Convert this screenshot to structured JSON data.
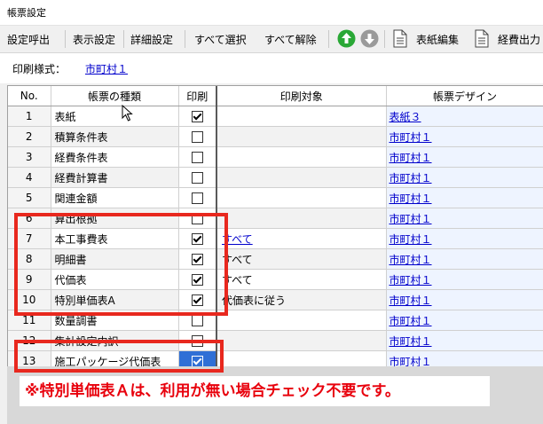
{
  "window": {
    "title": "帳票設定"
  },
  "toolbar": {
    "load_settings": "設定呼出",
    "display_settings": "表示設定",
    "detail_settings": "詳細設定",
    "select_all": "すべて選択",
    "deselect_all": "すべて解除",
    "up_icon": "arrow-up-circle",
    "down_icon": "arrow-down-circle",
    "form_edit": "表紙編集",
    "cost_output": "経費出力"
  },
  "print_style": {
    "label": "印刷様式：",
    "value": "市町村１"
  },
  "table": {
    "headers": [
      "No.",
      "帳票の種類",
      "印刷",
      "印刷対象",
      "帳票デザイン"
    ],
    "rows": [
      {
        "no": "1",
        "name": "表紙",
        "print": true,
        "target": "",
        "design": "表紙３"
      },
      {
        "no": "2",
        "name": "積算条件表",
        "print": false,
        "target": "",
        "design": "市町村１"
      },
      {
        "no": "3",
        "name": "経費条件表",
        "print": false,
        "target": "",
        "design": "市町村１"
      },
      {
        "no": "4",
        "name": "経費計算書",
        "print": false,
        "target": "",
        "design": "市町村１"
      },
      {
        "no": "5",
        "name": "関連金額",
        "print": false,
        "target": "",
        "design": "市町村１"
      },
      {
        "no": "6",
        "name": "算出根拠",
        "print": false,
        "target": "",
        "design": "市町村１"
      },
      {
        "no": "7",
        "name": "本工事費表",
        "print": true,
        "target": "すべて",
        "target_link": true,
        "design": "市町村１"
      },
      {
        "no": "8",
        "name": "明細書",
        "print": true,
        "target": "すべて",
        "design": "市町村１"
      },
      {
        "no": "9",
        "name": "代価表",
        "print": true,
        "target": "すべて",
        "design": "市町村１"
      },
      {
        "no": "10",
        "name": "特別単価表A",
        "print": true,
        "target": "代価表に従う",
        "design": "市町村１"
      },
      {
        "no": "11",
        "name": "数量調書",
        "print": false,
        "target": "",
        "design": "市町村１"
      },
      {
        "no": "12",
        "name": "集計設定内訳",
        "print": false,
        "target": "",
        "design": "市町村１"
      },
      {
        "no": "13",
        "name": "施工パッケージ代価表",
        "print": true,
        "target": "",
        "design": "市町村１",
        "selected": true
      }
    ]
  },
  "annotation": {
    "text": "※特別単価表Ａは、利用が無い場合チェック不要です。"
  },
  "colors": {
    "highlight_red": "#e8281e",
    "link_blue": "#0000cc",
    "selection_blue": "#2f6fd6",
    "annotation_red": "#e8000c"
  }
}
